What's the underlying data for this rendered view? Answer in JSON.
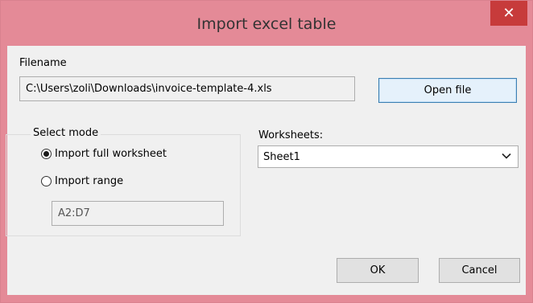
{
  "window": {
    "title": "Import excel table"
  },
  "filename": {
    "label": "Filename",
    "value": "C:\\Users\\zoli\\Downloads\\invoice-template-4.xls",
    "open_button": "Open file"
  },
  "mode": {
    "legend": "Select mode",
    "options": [
      {
        "label": "Import full worksheet",
        "selected": true
      },
      {
        "label": "Import range",
        "selected": false
      }
    ],
    "range_value": "A2:D7"
  },
  "worksheets": {
    "label": "Worksheets:",
    "selected": "Sheet1"
  },
  "footer": {
    "ok": "OK",
    "cancel": "Cancel"
  }
}
